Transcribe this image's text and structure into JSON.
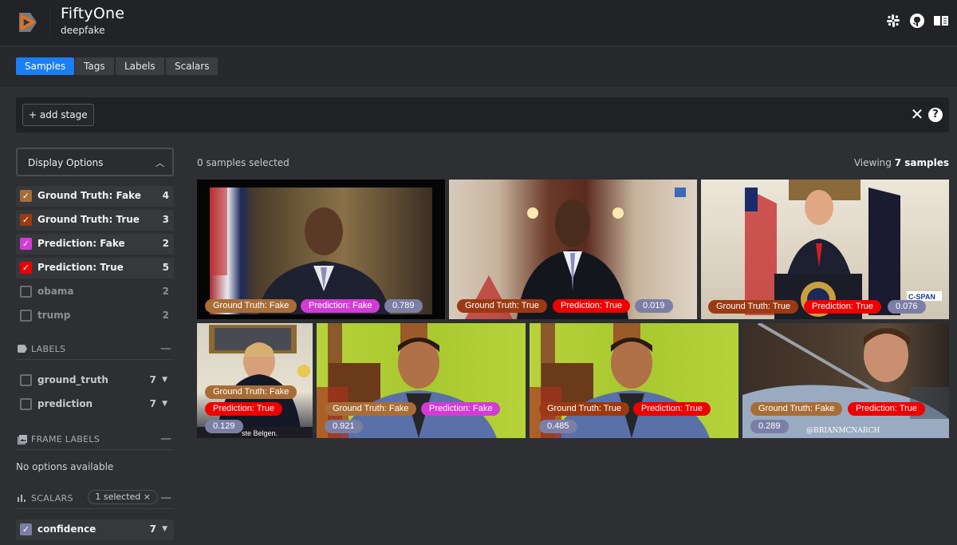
{
  "app": {
    "title": "FiftyOne",
    "dataset": "deepfake",
    "header_icons": [
      "slack-icon",
      "github-icon",
      "docs-book-icon"
    ]
  },
  "tabs": [
    {
      "label": "Samples",
      "active": true
    },
    {
      "label": "Tags",
      "active": false
    },
    {
      "label": "Labels",
      "active": false
    },
    {
      "label": "Scalars",
      "active": false
    }
  ],
  "stage_bar": {
    "add_stage_label": "+ add stage",
    "close_symbol": "✕",
    "help_symbol": "?"
  },
  "sidebar": {
    "display_options_label": "Display Options",
    "label_tags": [
      {
        "name": "Ground Truth: Fake",
        "count": "4",
        "checked": true,
        "color": "#a86d37"
      },
      {
        "name": "Ground Truth: True",
        "count": "3",
        "checked": true,
        "color": "#9b3a12"
      },
      {
        "name": "Prediction: Fake",
        "count": "2",
        "checked": true,
        "color": "#d23cd4"
      },
      {
        "name": "Prediction: True",
        "count": "5",
        "checked": true,
        "color": "#ee0000"
      }
    ],
    "sample_tags": [
      {
        "name": "obama",
        "count": "2",
        "checked": false
      },
      {
        "name": "trump",
        "count": "2",
        "checked": false
      }
    ],
    "labels_section": {
      "title": "LABELS",
      "items": [
        {
          "name": "ground_truth",
          "count": "7",
          "checked": false
        },
        {
          "name": "prediction",
          "count": "7",
          "checked": false
        }
      ]
    },
    "frame_labels_section": {
      "title": "FRAME LABELS",
      "empty_text": "No options available"
    },
    "scalars_section": {
      "title": "SCALARS",
      "selected_pill": "1 selected ×",
      "items": [
        {
          "name": "confidence",
          "count": "7",
          "checked": true,
          "color": "#7b7fa6"
        }
      ]
    },
    "collapse_symbol": "—"
  },
  "main": {
    "selected_text": "0 samples selected",
    "viewing_prefix": "Viewing",
    "viewing_count": "7 samples"
  },
  "samples": [
    {
      "subject": "obama",
      "ground_truth": "Ground Truth: Fake",
      "prediction": "Prediction: Fake",
      "confidence": "0.789"
    },
    {
      "subject": "obama",
      "ground_truth": "Ground Truth: True",
      "prediction": "Prediction: True",
      "confidence": "0.019"
    },
    {
      "subject": "trump",
      "ground_truth": "Ground Truth: True",
      "prediction": "Prediction: True",
      "confidence": "0.076",
      "watermark": "C-SPAN"
    },
    {
      "subject": "trump",
      "ground_truth": "Ground Truth: Fake",
      "prediction": "Prediction: True",
      "confidence": "0.129",
      "caption": "ste Belgen."
    },
    {
      "subject": "man-green-bg",
      "ground_truth": "Ground Truth: Fake",
      "prediction": "Prediction: Fake",
      "confidence": "0.921"
    },
    {
      "subject": "man-green-bg",
      "ground_truth": "Ground Truth: True",
      "prediction": "Prediction: True",
      "confidence": "0.485"
    },
    {
      "subject": "man-sword",
      "ground_truth": "Ground Truth: Fake",
      "prediction": "Prediction: True",
      "confidence": "0.289",
      "watermark": "@BRIANMCNARCH"
    }
  ],
  "tag_colors": {
    "Ground Truth: Fake": "#a86d37",
    "Ground Truth: True": "#9b3a12",
    "Prediction: Fake": "#d23cd4",
    "Prediction: True": "#ee0000"
  }
}
